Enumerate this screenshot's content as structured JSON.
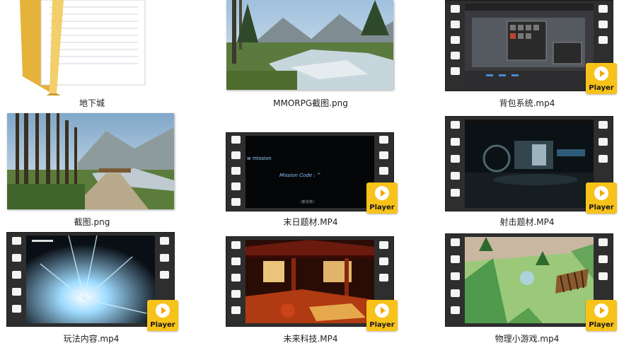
{
  "items": [
    {
      "label": "地下城",
      "type": "folder"
    },
    {
      "label": "MMORPG截图.png",
      "type": "image"
    },
    {
      "label": "背包系统.mp4",
      "type": "video"
    },
    {
      "label": "截图.png",
      "type": "image"
    },
    {
      "label": "末日题材.MP4",
      "type": "video"
    },
    {
      "label": "射击题材.MP4",
      "type": "video"
    },
    {
      "label": "玩法内容.mp4",
      "type": "video"
    },
    {
      "label": "未来科技.MP4",
      "type": "video"
    },
    {
      "label": "物理小游戏.mp4",
      "type": "video"
    }
  ],
  "badge": {
    "text": "Player"
  },
  "mission": {
    "title": "w mission",
    "code": "Mission Code : ^",
    "sub": "(新任务)"
  },
  "colors": {
    "badge": "#f7c21a",
    "film": "#2e2e2e",
    "folder": "#f1c84b"
  }
}
